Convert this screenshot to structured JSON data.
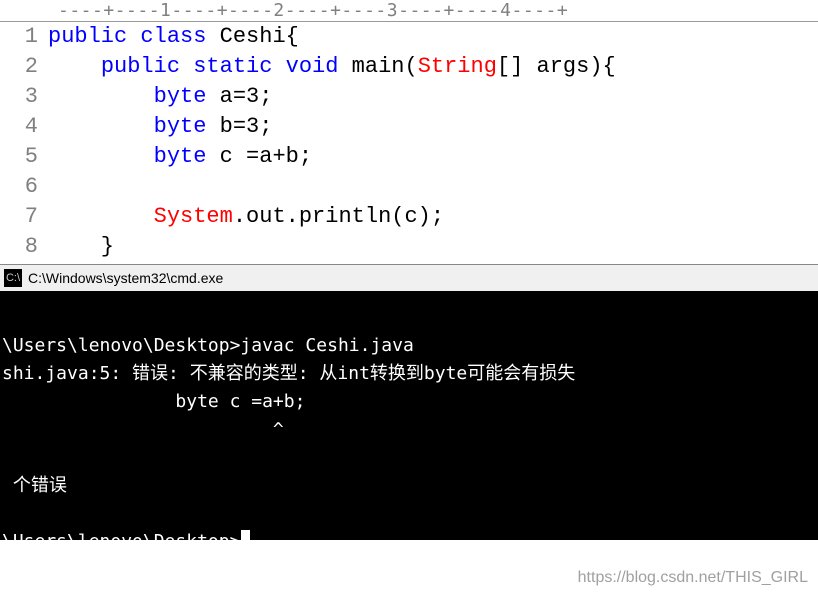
{
  "ruler": "----+----1----+----2----+----3----+----4----+",
  "editor": {
    "lines": [
      {
        "n": "1",
        "tokens": [
          {
            "cls": "kw",
            "t": "public"
          },
          {
            "cls": "plain",
            "t": " "
          },
          {
            "cls": "kw",
            "t": "class"
          },
          {
            "cls": "plain",
            "t": " Ceshi{"
          }
        ]
      },
      {
        "n": "2",
        "tokens": [
          {
            "cls": "plain",
            "t": "    "
          },
          {
            "cls": "kw",
            "t": "public"
          },
          {
            "cls": "plain",
            "t": " "
          },
          {
            "cls": "kw",
            "t": "static"
          },
          {
            "cls": "plain",
            "t": " "
          },
          {
            "cls": "kw",
            "t": "void"
          },
          {
            "cls": "plain",
            "t": " main("
          },
          {
            "cls": "type",
            "t": "String"
          },
          {
            "cls": "plain",
            "t": "[] args){"
          }
        ]
      },
      {
        "n": "3",
        "tokens": [
          {
            "cls": "plain",
            "t": "        "
          },
          {
            "cls": "kw",
            "t": "byte"
          },
          {
            "cls": "plain",
            "t": " a=3;"
          }
        ]
      },
      {
        "n": "4",
        "tokens": [
          {
            "cls": "plain",
            "t": "        "
          },
          {
            "cls": "kw",
            "t": "byte"
          },
          {
            "cls": "plain",
            "t": " b=3;"
          }
        ]
      },
      {
        "n": "5",
        "tokens": [
          {
            "cls": "plain",
            "t": "        "
          },
          {
            "cls": "kw",
            "t": "byte"
          },
          {
            "cls": "plain",
            "t": " c =a+b;"
          }
        ]
      },
      {
        "n": "6",
        "tokens": []
      },
      {
        "n": "7",
        "tokens": [
          {
            "cls": "plain",
            "t": "        "
          },
          {
            "cls": "sysred",
            "t": "System"
          },
          {
            "cls": "plain",
            "t": ".out.println(c);"
          }
        ]
      },
      {
        "n": "8",
        "tokens": [
          {
            "cls": "plain",
            "t": "    }"
          }
        ]
      }
    ]
  },
  "cmdTitle": "C:\\Windows\\system32\\cmd.exe",
  "terminal": {
    "l1": "\\Users\\lenovo\\Desktop>javac Ceshi.java",
    "l2": "shi.java:5: 错误: 不兼容的类型: 从int转换到byte可能会有损失",
    "l3": "                byte c =a+b;",
    "l4": "                         ^",
    "l5": " 个错误",
    "l6": "\\Users\\lenovo\\Desktop>"
  },
  "watermark": "https://blog.csdn.net/THIS_GIRL"
}
